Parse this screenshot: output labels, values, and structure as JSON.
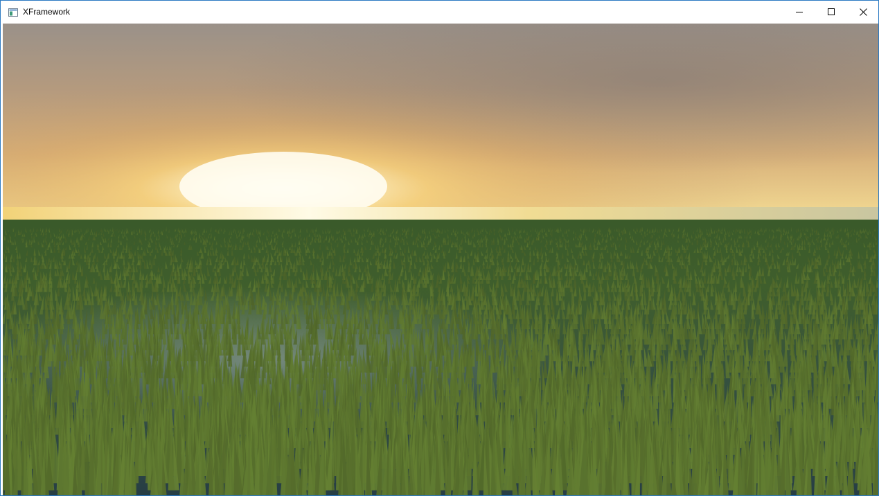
{
  "window": {
    "title": "XFramework",
    "icon": "app-window-icon",
    "controls": {
      "minimize_icon": "minimize-icon",
      "maximize_icon": "maximize-icon",
      "close_icon": "close-icon"
    }
  },
  "scene": {
    "description_icon": "3d-render-viewport",
    "colors": {
      "sky_top": "#8f8a86",
      "sky_glow": "#f2c36a",
      "sun": "#fffbe8",
      "horizon": "#f7e08a",
      "grass_far": "#3d5a2c",
      "grass_near": "#5e7a34",
      "water": "#1e3550",
      "accent_border": "#2b79c2"
    }
  }
}
